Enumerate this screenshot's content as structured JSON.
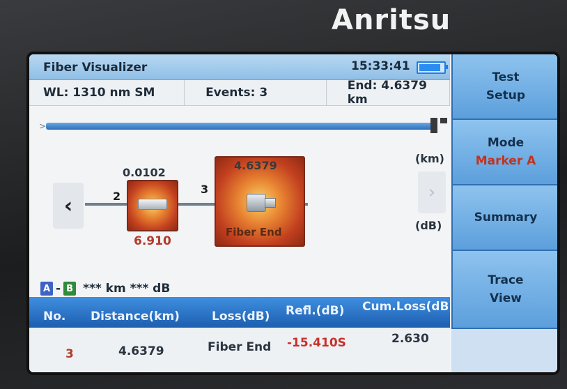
{
  "device": {
    "brand": "Anritsu"
  },
  "app": {
    "title": "Fiber Visualizer",
    "time": "15:33:41"
  },
  "info": {
    "wl": "WL: 1310 nm SM",
    "events": "Events: 3",
    "end": "End: 4.6379 km"
  },
  "units": {
    "distance": "(km)",
    "loss": "(dB)"
  },
  "visual": {
    "events": [
      {
        "number": "2",
        "distance": "0.0102",
        "loss": "6.910",
        "type": "splice"
      },
      {
        "number": "3",
        "distance": "4.6379",
        "label": "Fiber End",
        "type": "fiber-end"
      }
    ]
  },
  "marker": {
    "a_label": "A",
    "dash": "-",
    "b_label": "B",
    "readout": "*** km  *** dB"
  },
  "table": {
    "headers": {
      "no": "No.",
      "distance": "Distance(km)",
      "loss": "Loss(dB)",
      "refl": "Refl.(dB)",
      "cumloss": "Cum.Loss(dB)"
    },
    "rows": [
      {
        "no": "3",
        "distance": "4.6379",
        "loss": "Fiber End",
        "refl": "-15.410S",
        "cumloss": "2.630"
      }
    ]
  },
  "softkeys": [
    {
      "label": "Test\nSetup",
      "line1": "Test",
      "line2": "Setup"
    },
    {
      "line1": "Mode",
      "line2": "Marker A"
    },
    {
      "line1": "Summary"
    },
    {
      "line1": "Trace",
      "line2": "View"
    }
  ],
  "icons": {
    "nav_left": "chevron-left-icon",
    "nav_right": "chevron-right-icon",
    "battery": "battery-icon"
  },
  "colors": {
    "accent": "#1d5eb0",
    "softkey": "#5c9fdc",
    "warning_text": "#c2331f"
  }
}
